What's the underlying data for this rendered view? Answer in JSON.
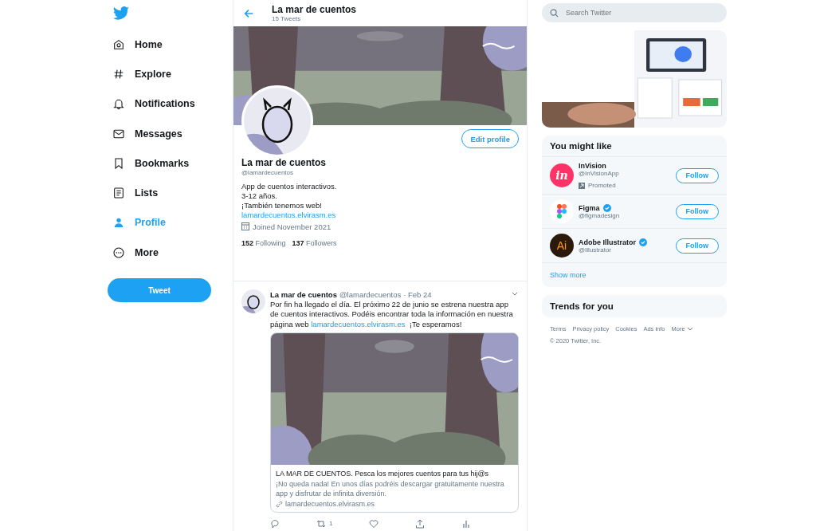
{
  "nav": {
    "items": [
      {
        "label": "Home",
        "selected": false
      },
      {
        "label": "Explore",
        "selected": false
      },
      {
        "label": "Notifications",
        "selected": false
      },
      {
        "label": "Messages",
        "selected": false
      },
      {
        "label": "Bookmarks",
        "selected": false
      },
      {
        "label": "Lists",
        "selected": false
      },
      {
        "label": "Profile",
        "selected": true
      },
      {
        "label": "More",
        "selected": false
      }
    ],
    "tweet_button": "Tweet"
  },
  "header": {
    "title": "La mar de cuentos",
    "subtitle": "15 Tweets"
  },
  "profile": {
    "edit_button": "Edit profile",
    "name": "La mar de cuentos",
    "handle": "@lamardecuentos",
    "bio": [
      "App de cuentos interactivos.",
      "3-12 años.",
      "¡También tenemos web!"
    ],
    "link": "lamardecuentos.elvirasm.es",
    "joined": "Joined November 2021",
    "stats": [
      "**152** Following",
      "**137** Followers"
    ]
  },
  "tweet": {
    "name": "La mar de cuentos",
    "handle": "@lamardecuentos",
    "date": "· Feb 24",
    "text_before": "Por fin ha llegado el día. El próximo 22 de junio se estrena nuestra app de cuentos interactivos. Podéis encontrar toda la información en nuestra página web ",
    "link": "lamardecuentos.elvirasm.es",
    "text_after": "  ¡Te esperamos!",
    "card": {
      "title": "LA MAR DE CUENTOS. Pesca los mejores cuentos para tus hij@s",
      "description": "¡No queda nada! En unos días podréis descargar gratuitamente nuestra app y disfrutar de infinita diversión.",
      "url": "lamardecuentos.elvirasm.es"
    },
    "retweet_count": "1"
  },
  "search": {
    "placeholder": "Search Twitter"
  },
  "who_to_follow": {
    "title": "You might like",
    "accounts": [
      {
        "name": "InVision",
        "handle": "@InVisionApp",
        "verified": false,
        "promoted": "Promoted",
        "logo_text": "in",
        "color": "#ff3366",
        "button": "Follow"
      },
      {
        "name": "Figma",
        "handle": "@figmadesign",
        "verified": true,
        "color": "#ffffff",
        "button": "Follow"
      },
      {
        "name": "Adobe Illustrator",
        "handle": "@Illustrator",
        "verified": true,
        "logo_text": "Ai",
        "color": "#2b1a0c",
        "button": "Follow"
      }
    ],
    "show_more": "Show more"
  },
  "trends": {
    "title": "Trends for you"
  },
  "footer": {
    "links": [
      "Terms",
      "Privacy policy",
      "Cookies",
      "Ads info",
      "More"
    ],
    "copyright": "© 2020 Twitter, Inc."
  }
}
